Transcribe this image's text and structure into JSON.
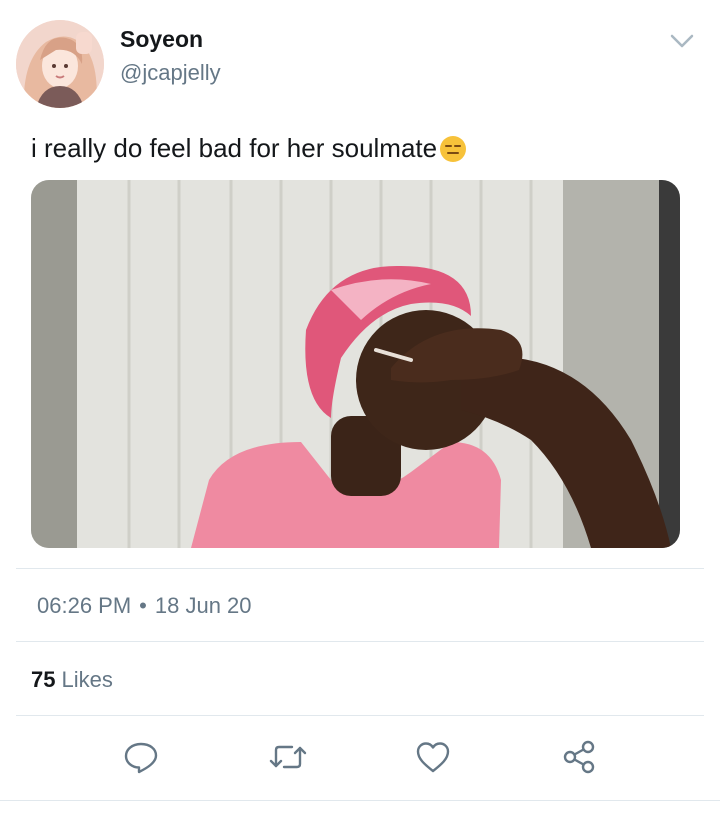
{
  "tweet": {
    "author": {
      "display_name": "Soyeon",
      "handle": "@jcapjelly"
    },
    "text": "i really do feel bad for her soulmate",
    "emoji": "expressionless-face-emoji",
    "time": "06:26 PM",
    "separator": "•",
    "date": "18 Jun 20",
    "likes_count": "75",
    "likes_label": "Likes"
  },
  "icons": {
    "menu": "chevron-down-icon",
    "reply": "reply-icon",
    "retweet": "retweet-icon",
    "like": "heart-icon",
    "share": "share-icon"
  },
  "colors": {
    "text_primary": "#14171a",
    "text_secondary": "#657786",
    "divider": "#e1e8ed"
  }
}
